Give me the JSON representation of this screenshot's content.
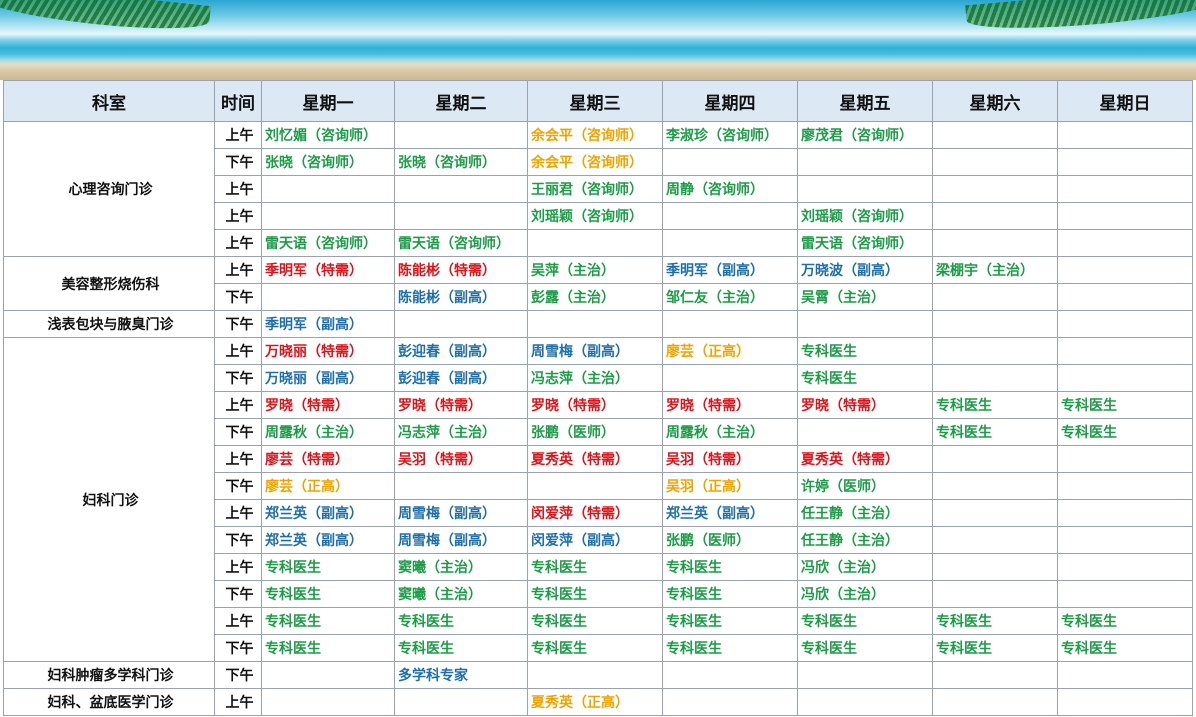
{
  "header": [
    "科室",
    "时间",
    "星期一",
    "星期二",
    "星期三",
    "星期四",
    "星期五",
    "星期六",
    "星期日"
  ],
  "colors": {
    "green": "#1e9b48",
    "blue": "#1f6ea8",
    "red": "#d9141b",
    "orange": "#eea400"
  },
  "groups": [
    {
      "dept": "心理咨询门诊",
      "rows": [
        {
          "time": "上午",
          "cells": [
            {
              "t": "刘忆媚（咨询师）",
              "c": "green"
            },
            {
              "t": "",
              "c": ""
            },
            {
              "t": "余会平（咨询师）",
              "c": "orange"
            },
            {
              "t": "李淑珍（咨询师）",
              "c": "green"
            },
            {
              "t": "廖茂君（咨询师）",
              "c": "green"
            },
            {
              "t": "",
              "c": ""
            },
            {
              "t": "",
              "c": ""
            }
          ]
        },
        {
          "time": "下午",
          "cells": [
            {
              "t": "张晓（咨询师）",
              "c": "green"
            },
            {
              "t": "张晓（咨询师）",
              "c": "green"
            },
            {
              "t": "余会平（咨询师）",
              "c": "orange"
            },
            {
              "t": "",
              "c": ""
            },
            {
              "t": "",
              "c": ""
            },
            {
              "t": "",
              "c": ""
            },
            {
              "t": "",
              "c": ""
            }
          ]
        },
        {
          "time": "上午",
          "cells": [
            {
              "t": "",
              "c": ""
            },
            {
              "t": "",
              "c": ""
            },
            {
              "t": "王丽君（咨询师）",
              "c": "green"
            },
            {
              "t": "周静（咨询师）",
              "c": "green"
            },
            {
              "t": "",
              "c": ""
            },
            {
              "t": "",
              "c": ""
            },
            {
              "t": "",
              "c": ""
            }
          ]
        },
        {
          "time": "上午",
          "cells": [
            {
              "t": "",
              "c": ""
            },
            {
              "t": "",
              "c": ""
            },
            {
              "t": "刘瑶颖（咨询师）",
              "c": "green"
            },
            {
              "t": "",
              "c": ""
            },
            {
              "t": "刘瑶颖（咨询师）",
              "c": "green"
            },
            {
              "t": "",
              "c": ""
            },
            {
              "t": "",
              "c": ""
            }
          ]
        },
        {
          "time": "上午",
          "cells": [
            {
              "t": "雷天语（咨询师）",
              "c": "green"
            },
            {
              "t": "雷天语（咨询师）",
              "c": "green"
            },
            {
              "t": "",
              "c": ""
            },
            {
              "t": "",
              "c": ""
            },
            {
              "t": "雷天语（咨询师）",
              "c": "green"
            },
            {
              "t": "",
              "c": ""
            },
            {
              "t": "",
              "c": ""
            }
          ]
        }
      ]
    },
    {
      "dept": "美容整形烧伤科",
      "rows": [
        {
          "time": "上午",
          "cells": [
            {
              "t": "季明军（特需）",
              "c": "red"
            },
            {
              "t": "陈能彬（特需）",
              "c": "red"
            },
            {
              "t": "吴萍（主治）",
              "c": "green"
            },
            {
              "t": "季明军（副高）",
              "c": "blue"
            },
            {
              "t": "万晓波（副高）",
              "c": "blue"
            },
            {
              "t": "梁棚宇（主治）",
              "c": "green"
            },
            {
              "t": "",
              "c": ""
            }
          ]
        },
        {
          "time": "下午",
          "cells": [
            {
              "t": "",
              "c": ""
            },
            {
              "t": "陈能彬（副高）",
              "c": "blue"
            },
            {
              "t": "彭露（主治）",
              "c": "green"
            },
            {
              "t": "邹仁友（主治）",
              "c": "green"
            },
            {
              "t": "吴霄（主治）",
              "c": "green"
            },
            {
              "t": "",
              "c": ""
            },
            {
              "t": "",
              "c": ""
            }
          ]
        }
      ]
    },
    {
      "dept": "浅表包块与腋臭门诊",
      "rows": [
        {
          "time": "下午",
          "cells": [
            {
              "t": "季明军（副高）",
              "c": "blue"
            },
            {
              "t": "",
              "c": ""
            },
            {
              "t": "",
              "c": ""
            },
            {
              "t": "",
              "c": ""
            },
            {
              "t": "",
              "c": ""
            },
            {
              "t": "",
              "c": ""
            },
            {
              "t": "",
              "c": ""
            }
          ]
        }
      ]
    },
    {
      "dept": "妇科门诊",
      "rows": [
        {
          "time": "上午",
          "cells": [
            {
              "t": "万晓丽（特需）",
              "c": "red"
            },
            {
              "t": "彭迎春（副高）",
              "c": "blue"
            },
            {
              "t": "周雪梅（副高）",
              "c": "blue"
            },
            {
              "t": "廖芸（正高）",
              "c": "orange"
            },
            {
              "t": "专科医生",
              "c": "green"
            },
            {
              "t": "",
              "c": ""
            },
            {
              "t": "",
              "c": ""
            }
          ]
        },
        {
          "time": "下午",
          "cells": [
            {
              "t": "万晓丽（副高）",
              "c": "blue"
            },
            {
              "t": "彭迎春（副高）",
              "c": "blue"
            },
            {
              "t": "冯志萍（主治）",
              "c": "green"
            },
            {
              "t": "",
              "c": ""
            },
            {
              "t": "专科医生",
              "c": "green"
            },
            {
              "t": "",
              "c": ""
            },
            {
              "t": "",
              "c": ""
            }
          ]
        },
        {
          "time": "上午",
          "cells": [
            {
              "t": "罗晓（特需）",
              "c": "red"
            },
            {
              "t": "罗晓（特需）",
              "c": "red"
            },
            {
              "t": "罗晓（特需）",
              "c": "red"
            },
            {
              "t": "罗晓（特需）",
              "c": "red"
            },
            {
              "t": "罗晓（特需）",
              "c": "red"
            },
            {
              "t": "专科医生",
              "c": "green"
            },
            {
              "t": "专科医生",
              "c": "green"
            }
          ]
        },
        {
          "time": "下午",
          "cells": [
            {
              "t": "周露秋（主治）",
              "c": "green"
            },
            {
              "t": "冯志萍（主治）",
              "c": "green"
            },
            {
              "t": "张鹏（医师）",
              "c": "green"
            },
            {
              "t": "周露秋（主治）",
              "c": "green"
            },
            {
              "t": "",
              "c": ""
            },
            {
              "t": "专科医生",
              "c": "green"
            },
            {
              "t": "专科医生",
              "c": "green"
            }
          ]
        },
        {
          "time": "上午",
          "cells": [
            {
              "t": "廖芸（特需）",
              "c": "red"
            },
            {
              "t": "吴羽（特需）",
              "c": "red"
            },
            {
              "t": "夏秀英（特需）",
              "c": "red"
            },
            {
              "t": "吴羽（特需）",
              "c": "red"
            },
            {
              "t": "夏秀英（特需）",
              "c": "red"
            },
            {
              "t": "",
              "c": ""
            },
            {
              "t": "",
              "c": ""
            }
          ]
        },
        {
          "time": "下午",
          "cells": [
            {
              "t": "廖芸（正高）",
              "c": "orange"
            },
            {
              "t": "",
              "c": ""
            },
            {
              "t": "",
              "c": ""
            },
            {
              "t": "吴羽（正高）",
              "c": "orange"
            },
            {
              "t": "许婷（医师）",
              "c": "green"
            },
            {
              "t": "",
              "c": ""
            },
            {
              "t": "",
              "c": ""
            }
          ]
        },
        {
          "time": "上午",
          "cells": [
            {
              "t": "郑兰英（副高）",
              "c": "blue"
            },
            {
              "t": "周雪梅（副高）",
              "c": "blue"
            },
            {
              "t": "闵爱萍（特需）",
              "c": "red"
            },
            {
              "t": "郑兰英（副高）",
              "c": "blue"
            },
            {
              "t": "任王静（主治）",
              "c": "green"
            },
            {
              "t": "",
              "c": ""
            },
            {
              "t": "",
              "c": ""
            }
          ]
        },
        {
          "time": "下午",
          "cells": [
            {
              "t": "郑兰英（副高）",
              "c": "blue"
            },
            {
              "t": "周雪梅（副高）",
              "c": "blue"
            },
            {
              "t": "闵爱萍（副高）",
              "c": "blue"
            },
            {
              "t": "张鹏（医师）",
              "c": "green"
            },
            {
              "t": "任王静（主治）",
              "c": "green"
            },
            {
              "t": "",
              "c": ""
            },
            {
              "t": "",
              "c": ""
            }
          ]
        },
        {
          "time": "上午",
          "cells": [
            {
              "t": "专科医生",
              "c": "green"
            },
            {
              "t": "窦曦（主治）",
              "c": "green"
            },
            {
              "t": "专科医生",
              "c": "green"
            },
            {
              "t": "专科医生",
              "c": "green"
            },
            {
              "t": "冯欣（主治）",
              "c": "green"
            },
            {
              "t": "",
              "c": ""
            },
            {
              "t": "",
              "c": ""
            }
          ]
        },
        {
          "time": "下午",
          "cells": [
            {
              "t": "专科医生",
              "c": "green"
            },
            {
              "t": "窦曦（主治）",
              "c": "green"
            },
            {
              "t": "专科医生",
              "c": "green"
            },
            {
              "t": "专科医生",
              "c": "green"
            },
            {
              "t": "冯欣（主治）",
              "c": "green"
            },
            {
              "t": "",
              "c": ""
            },
            {
              "t": "",
              "c": ""
            }
          ]
        },
        {
          "time": "上午",
          "cells": [
            {
              "t": "专科医生",
              "c": "green"
            },
            {
              "t": "专科医生",
              "c": "green"
            },
            {
              "t": "专科医生",
              "c": "green"
            },
            {
              "t": "专科医生",
              "c": "green"
            },
            {
              "t": "专科医生",
              "c": "green"
            },
            {
              "t": "专科医生",
              "c": "green"
            },
            {
              "t": "专科医生",
              "c": "green"
            }
          ]
        },
        {
          "time": "下午",
          "cells": [
            {
              "t": "专科医生",
              "c": "green"
            },
            {
              "t": "专科医生",
              "c": "green"
            },
            {
              "t": "专科医生",
              "c": "green"
            },
            {
              "t": "专科医生",
              "c": "green"
            },
            {
              "t": "专科医生",
              "c": "green"
            },
            {
              "t": "专科医生",
              "c": "green"
            },
            {
              "t": "专科医生",
              "c": "green"
            }
          ]
        }
      ]
    },
    {
      "dept": "妇科肿瘤多学科门诊",
      "rows": [
        {
          "time": "下午",
          "cells": [
            {
              "t": "",
              "c": ""
            },
            {
              "t": "多学科专家",
              "c": "blue"
            },
            {
              "t": "",
              "c": ""
            },
            {
              "t": "",
              "c": ""
            },
            {
              "t": "",
              "c": ""
            },
            {
              "t": "",
              "c": ""
            },
            {
              "t": "",
              "c": ""
            }
          ]
        }
      ]
    },
    {
      "dept": "妇科、盆底医学门诊",
      "rows": [
        {
          "time": "上午",
          "cells": [
            {
              "t": "",
              "c": ""
            },
            {
              "t": "",
              "c": ""
            },
            {
              "t": "夏秀英（正高）",
              "c": "orange"
            },
            {
              "t": "",
              "c": ""
            },
            {
              "t": "",
              "c": ""
            },
            {
              "t": "",
              "c": ""
            },
            {
              "t": "",
              "c": ""
            }
          ]
        }
      ]
    }
  ]
}
